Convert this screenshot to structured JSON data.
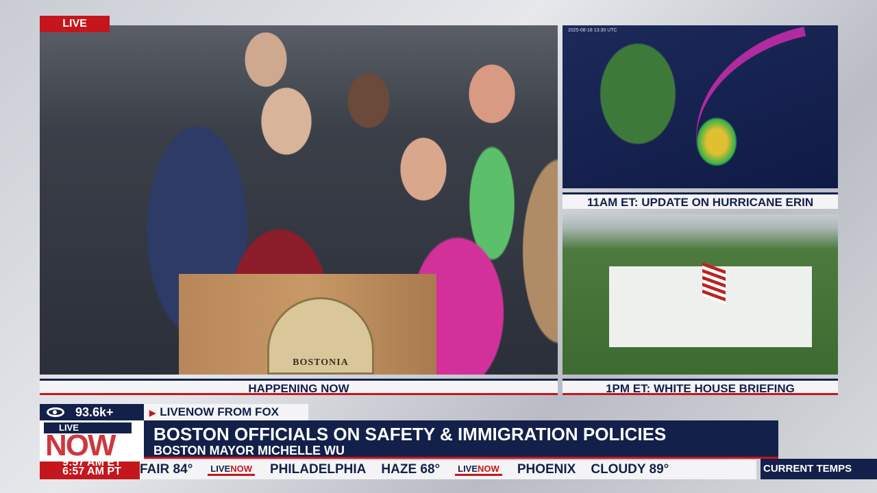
{
  "live_tag": "LIVE",
  "main_caption": "HAPPENING NOW",
  "podium_seal_text": "BOSTONIA",
  "side_panels": [
    {
      "caption": "11AM ET: UPDATE ON HURRICANE ERIN",
      "timestamp": "2025-08-18 13:30 UTC"
    },
    {
      "caption": "1PM ET: WHITE HOUSE BRIEFING"
    }
  ],
  "viewers": "93.6k+",
  "source": "LIVENOW FROM FOX",
  "logo": {
    "top": "LIVE",
    "bottom": "NOW"
  },
  "clock": {
    "et": "9:57 AM ET",
    "pt": "6:57 AM PT"
  },
  "headline": {
    "title": "BOSTON OFFICIALS ON SAFETY & IMMIGRATION POLICIES",
    "subtitle": "BOSTON MAYOR MICHELLE WU"
  },
  "ticker": {
    "items": [
      {
        "text": "FAIR 84°"
      },
      {
        "logo": "LIVE",
        "logo2": "NOW"
      },
      {
        "text": "PHILADELPHIA"
      },
      {
        "text": "HAZE 68°"
      },
      {
        "logo": "LIVE",
        "logo2": "NOW"
      },
      {
        "text": "PHOENIX"
      },
      {
        "text": "CLOUDY 89°"
      }
    ],
    "label": "CURRENT TEMPS"
  },
  "colors": {
    "navy": "#13204a",
    "red": "#c4161c"
  }
}
